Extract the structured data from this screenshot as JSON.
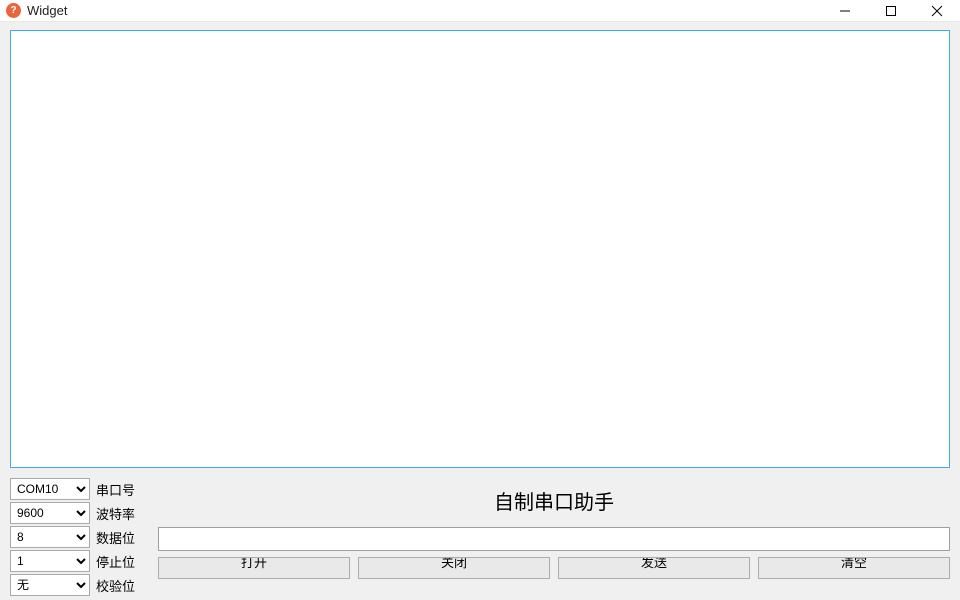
{
  "window": {
    "title": "Widget"
  },
  "config": {
    "port": {
      "label": "串口号",
      "value": "COM10"
    },
    "baud": {
      "label": "波特率",
      "value": "9600"
    },
    "databits": {
      "label": "数据位",
      "value": "8"
    },
    "stopbits": {
      "label": "停止位",
      "value": "1"
    },
    "parity": {
      "label": "校验位",
      "value": "无"
    }
  },
  "main": {
    "title": "自制串口助手",
    "input_value": ""
  },
  "buttons": {
    "open": "打开",
    "close": "关闭",
    "send": "发送",
    "clear": "清空"
  }
}
